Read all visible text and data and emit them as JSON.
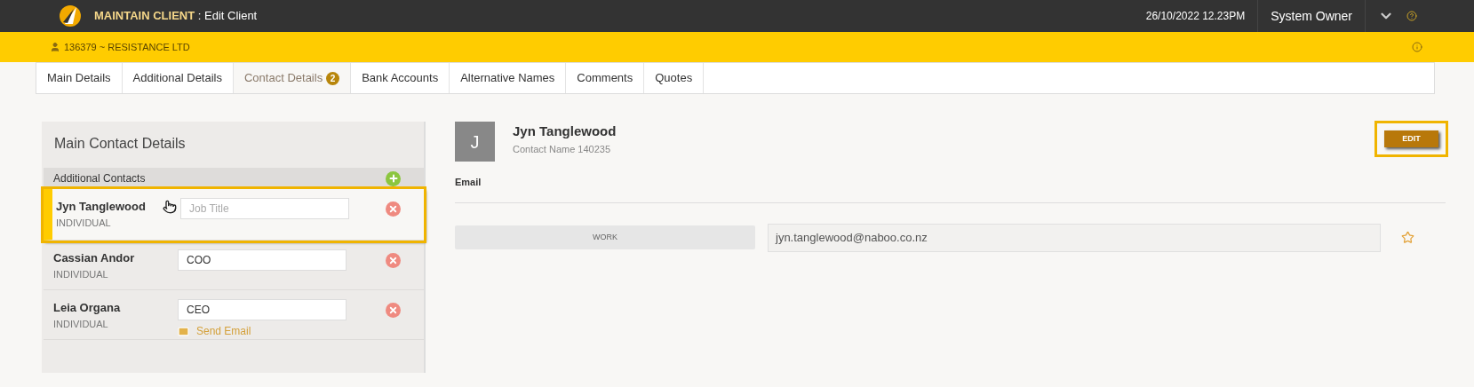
{
  "header": {
    "app": "MAINTAIN CLIENT",
    "separator": " : ",
    "page": "Edit Client",
    "datetime": "26/10/2022 12.23PM",
    "user": "System Owner"
  },
  "client_bar": {
    "client": "136379 ~ RESISTANCE LTD"
  },
  "tabs": [
    {
      "label": "Main Details",
      "selected": false
    },
    {
      "label": "Additional Details",
      "selected": false
    },
    {
      "label": "Contact Details",
      "selected": true,
      "badge": "2"
    },
    {
      "label": "Bank Accounts",
      "selected": false
    },
    {
      "label": "Alternative Names",
      "selected": false
    },
    {
      "label": "Comments",
      "selected": false
    },
    {
      "label": "Quotes",
      "selected": false
    }
  ],
  "contacts_panel": {
    "title": "Main Contact Details",
    "subtitle": "Additional Contacts",
    "contacts": [
      {
        "name": "Jyn Tanglewood",
        "type": "INDIVIDUAL",
        "placeholder": "Job Title",
        "selected": true
      },
      {
        "name": "Cassian Andor",
        "type": "INDIVIDUAL",
        "value": "COO",
        "selected": false
      },
      {
        "name": "Leia Organa",
        "type": "INDIVIDUAL",
        "value": "CEO",
        "selected": false,
        "link": "Send Email"
      }
    ]
  },
  "detail": {
    "initial": "J",
    "name": "Jyn Tanglewood",
    "subtitle": "Contact Name 140235",
    "edit_button": {
      "label": "EDIT",
      "highlighted": true
    },
    "section": "Email",
    "emails": [
      {
        "label": "WORK",
        "value": "jyn.tanglewood@naboo.co.nz",
        "starred": false
      }
    ]
  }
}
